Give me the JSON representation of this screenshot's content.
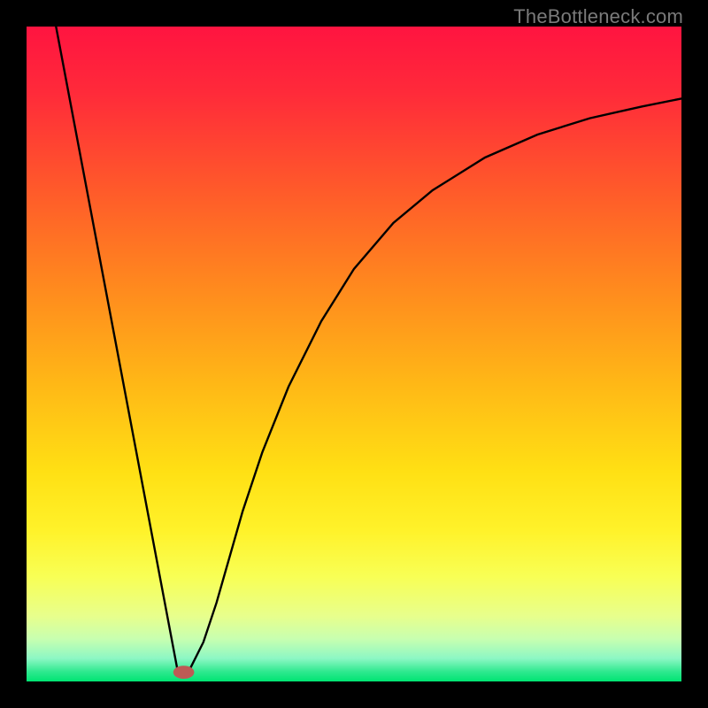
{
  "watermark": "TheBottleneck.com",
  "chart_data": {
    "type": "line",
    "title": "",
    "xlabel": "",
    "ylabel": "",
    "xlim": [
      0,
      100
    ],
    "ylim": [
      0,
      100
    ],
    "gradient_stops": [
      {
        "pos": 0.0,
        "color": "#ff1440"
      },
      {
        "pos": 0.1,
        "color": "#ff2a3a"
      },
      {
        "pos": 0.25,
        "color": "#ff5a2a"
      },
      {
        "pos": 0.4,
        "color": "#ff8a1e"
      },
      {
        "pos": 0.55,
        "color": "#ffb916"
      },
      {
        "pos": 0.68,
        "color": "#ffe014"
      },
      {
        "pos": 0.77,
        "color": "#fff22a"
      },
      {
        "pos": 0.84,
        "color": "#f8ff55"
      },
      {
        "pos": 0.9,
        "color": "#e8ff8c"
      },
      {
        "pos": 0.935,
        "color": "#c8ffb0"
      },
      {
        "pos": 0.965,
        "color": "#8cf7c4"
      },
      {
        "pos": 0.985,
        "color": "#2fe98f"
      },
      {
        "pos": 1.0,
        "color": "#00e472"
      }
    ],
    "series": [
      {
        "name": "left-line",
        "x": [
          4.5,
          23.0
        ],
        "y": [
          100.0,
          2.0
        ]
      },
      {
        "name": "right-curve",
        "x": [
          25.0,
          27.0,
          29.0,
          31.0,
          33.0,
          36.0,
          40.0,
          45.0,
          50.0,
          56.0,
          62.0,
          70.0,
          78.0,
          86.0,
          94.0,
          100.0
        ],
        "y": [
          2.0,
          6.0,
          12.0,
          19.0,
          26.0,
          35.0,
          45.0,
          55.0,
          63.0,
          70.0,
          75.0,
          80.0,
          83.5,
          86.0,
          87.8,
          89.0
        ]
      }
    ],
    "marker": {
      "x": 24.0,
      "y": 1.4,
      "rx": 1.6,
      "ry": 1.0,
      "color": "#bd5a55"
    }
  }
}
